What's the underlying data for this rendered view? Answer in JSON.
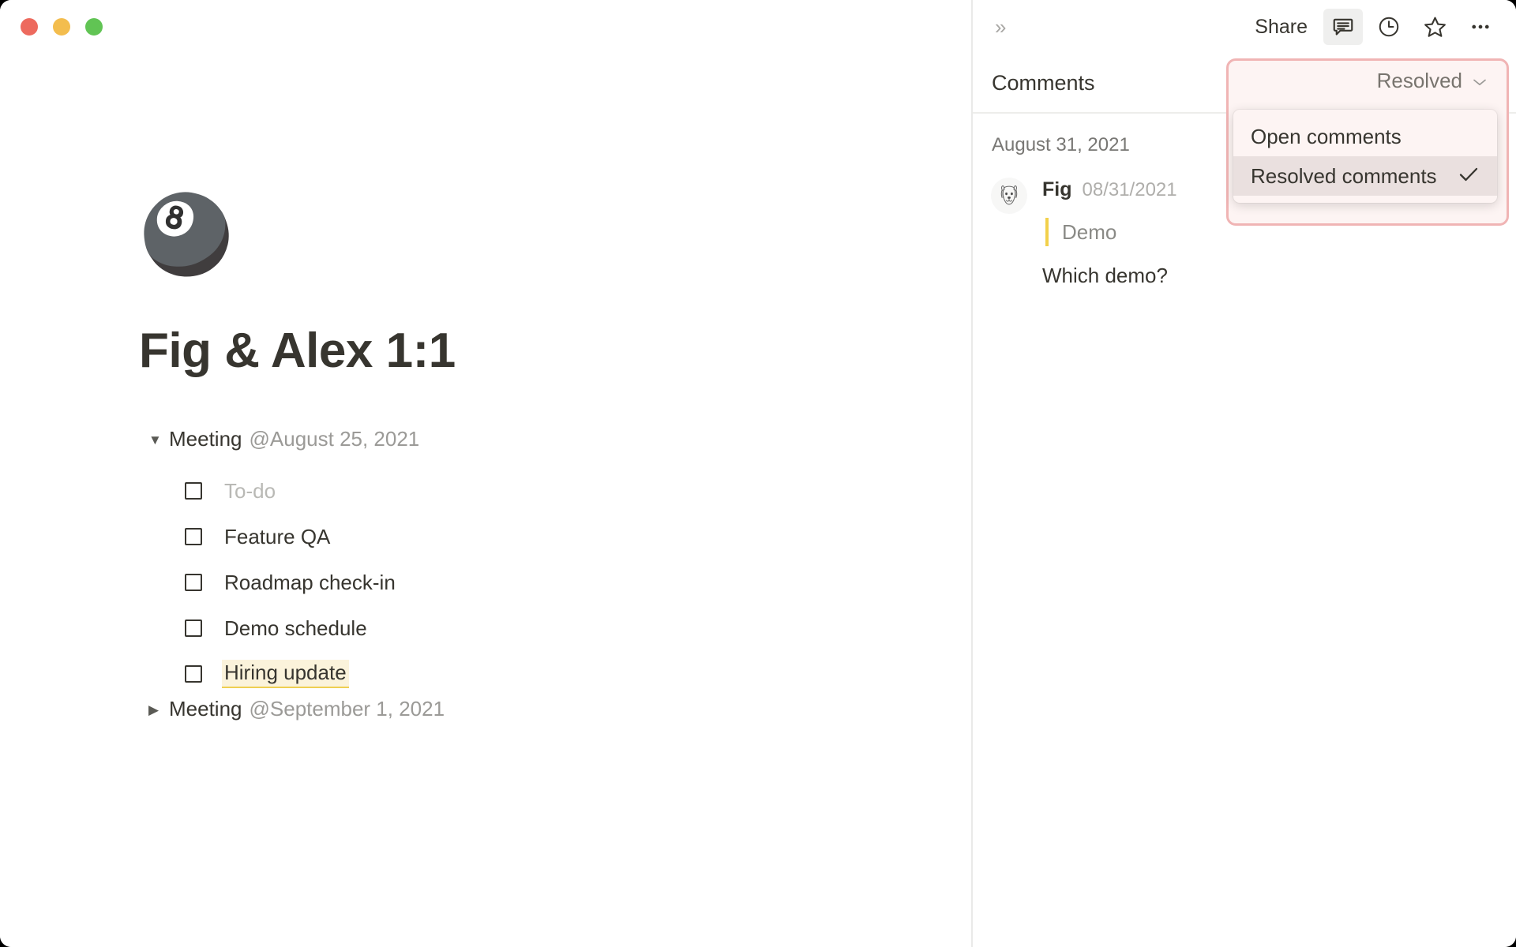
{
  "window": {
    "traffic_lights": [
      {
        "name": "close",
        "color": "#ED6A5E"
      },
      {
        "name": "minimize",
        "color": "#F3BD4E"
      },
      {
        "name": "maximize",
        "color": "#61C454"
      }
    ]
  },
  "document": {
    "emoji": "🎱",
    "emoji_name": "pool-8-ball-icon",
    "title": "Fig & Alex 1:1",
    "blocks": [
      {
        "type": "toggle",
        "state": "expanded",
        "label": "Meeting",
        "mention": "@August 25, 2021",
        "children": [
          {
            "type": "todo",
            "text": "To-do",
            "checked": false,
            "style": "placeholder"
          },
          {
            "type": "todo",
            "text": "Feature QA",
            "checked": false,
            "style": "normal"
          },
          {
            "type": "todo",
            "text": "Roadmap check-in",
            "checked": false,
            "style": "normal"
          },
          {
            "type": "todo",
            "text": "Demo schedule",
            "checked": false,
            "style": "normal"
          },
          {
            "type": "todo",
            "text": "Hiring update",
            "checked": false,
            "style": "highlighted"
          }
        ]
      },
      {
        "type": "toggle",
        "state": "collapsed",
        "label": "Meeting",
        "mention": "@September 1, 2021",
        "children": []
      }
    ]
  },
  "sidebar": {
    "toolbar": {
      "expand_icon": "»",
      "expand_icon_name": "expand-panel-icon",
      "share_label": "Share",
      "icons": [
        {
          "name": "comment-bubble-icon",
          "active": true
        },
        {
          "name": "history-clock-icon",
          "active": false
        },
        {
          "name": "favorite-star-icon",
          "active": false
        },
        {
          "name": "more-options-icon",
          "active": false
        }
      ]
    },
    "header": {
      "title": "Comments"
    },
    "filter": {
      "selected_label": "Resolved",
      "chevron": "⌄",
      "focus_border_color": "#F0B4B4",
      "menu_open": true,
      "options": [
        {
          "label": "Open comments",
          "selected": false,
          "check": ""
        },
        {
          "label": "Resolved comments",
          "selected": true,
          "check": "✓"
        }
      ]
    },
    "threads": [
      {
        "date_header": "August 31, 2021",
        "author": "Fig",
        "timestamp": "08/31/2021",
        "avatar_name": "dog-face-avatar",
        "quoted_text": "Demo",
        "quote_bar_color": "#F2D04B",
        "body": "Which demo?"
      }
    ]
  }
}
